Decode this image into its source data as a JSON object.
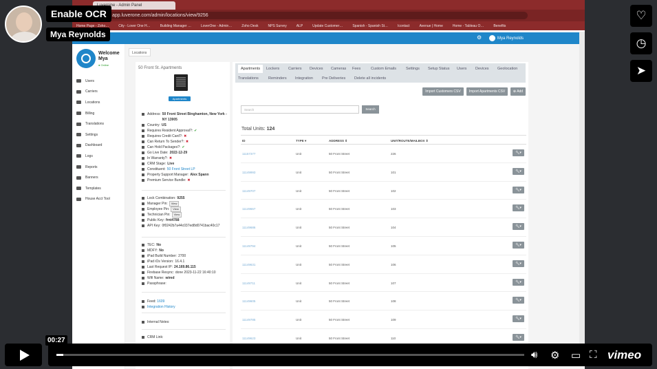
{
  "browser": {
    "tab_title": "Luvernine - Admin Panel",
    "url": "app.luverone.com/admin/locations/view/9256",
    "bookmarks": [
      "Home Page - Zoho…",
      "City - Lover One H…",
      "Building Manager …",
      "LoverOne - Admin…",
      "Zoho Desk",
      "NPS Survey",
      "ALP",
      "Update Customer…",
      "Spanish - Spanish St…",
      "Icontact",
      "Avenue | Home",
      "Home - Tableau O…",
      "Benefits"
    ]
  },
  "app": {
    "header_user": "Mya Reynolds",
    "sidebar_title_line1": "Welcome",
    "sidebar_title_line2": "Mya",
    "online": "● Online",
    "nav": [
      "Users",
      "Carriers",
      "Locations",
      "Billing",
      "Translations",
      "Settings",
      "Dashboard",
      "Logs",
      "Reports",
      "Banners",
      "Templates",
      "House Acct Tool"
    ]
  },
  "breadcrumb_tab": "Locations",
  "location": {
    "name": "50 Front St. Apartments",
    "type_badge": "Apartments",
    "details": [
      {
        "label": "Address:",
        "value": "50 Front Street Binghamton, New York - NY 13905",
        "style": "bold"
      },
      {
        "label": "Country:",
        "value": "US",
        "style": "bold"
      },
      {
        "label": "Requires Resident Approval?:",
        "value": "✔",
        "style": "ok"
      },
      {
        "label": "Requires Credit Card?:",
        "value": "✖",
        "style": "no"
      },
      {
        "label": "Can Return To Sender?:",
        "value": "✖",
        "style": "no"
      },
      {
        "label": "Can Hold Packages?:",
        "value": "✔",
        "style": "ok"
      },
      {
        "label": "Go Live Date:",
        "value": "2022-12-29",
        "style": "bold"
      },
      {
        "label": "In Warranty?:",
        "value": "✖",
        "style": "no"
      },
      {
        "label": "CRM Stage:",
        "value": "Live",
        "style": "bold"
      },
      {
        "label": "Constituent:",
        "value": "50 Front Street LP",
        "style": "link"
      },
      {
        "label": "Property Support Manager:",
        "value": "Alex Spann",
        "style": "bold"
      },
      {
        "label": "Premium Service Bundle:",
        "value": "✖",
        "style": "no"
      }
    ],
    "security": [
      {
        "label": "Lock Combination:",
        "value": "9255",
        "style": "bold"
      },
      {
        "label": "Manager Pin:",
        "value": "View",
        "style": "button"
      },
      {
        "label": "Employee Pin:",
        "value": "View",
        "style": "button"
      },
      {
        "label": "Technician Pin:",
        "value": "View",
        "style": "button"
      },
      {
        "label": "Public Key:",
        "value": "frnt4788",
        "style": "bold"
      },
      {
        "label": "API Key:",
        "value": "0f0242b7a44c037ed8d0741bac40c17",
        "style": "plain"
      }
    ],
    "device": [
      {
        "label": "TEC:",
        "value": "No",
        "style": "bold"
      },
      {
        "label": "MDFY:",
        "value": "No",
        "style": "bold"
      },
      {
        "label": "iPad Build Number:",
        "value": "2700",
        "style": "plain"
      },
      {
        "label": "iPad iOs Version:",
        "value": "16.4.1",
        "style": "plain"
      },
      {
        "label": "Last Request IP:",
        "value": "24.169.86.115",
        "style": "bold"
      },
      {
        "label": "Firebase Resync:",
        "value": "done 2023-11-22 16:40:10",
        "style": "plain"
      },
      {
        "label": "Wifi Name:",
        "value": "wired",
        "style": "bold"
      },
      {
        "label": "Passphrase:",
        "value": "",
        "style": "plain"
      }
    ],
    "feed_label": "Feed:",
    "feed_value": "1609",
    "integration_history": "Integration History",
    "internal_notes": "Internal Notes:",
    "crm_link": "CRM Link:"
  },
  "tabs_row1": [
    "Apartments",
    "Lockers",
    "Carriers",
    "Devices",
    "Cameras",
    "Fees",
    "Custom Emails",
    "Settings",
    "Setup Status",
    "Users",
    "Devices",
    "Geolocation"
  ],
  "tabs_row2": [
    "Translations",
    "Reminders",
    "Integration",
    "Pre Deliveries",
    "Delete all incidents"
  ],
  "actions": {
    "import_customers": "Import Customers CSV",
    "import_apartments": "Import Apartments CSV",
    "add": "⊕ Add"
  },
  "search": {
    "placeholder": "Search",
    "button": "Search"
  },
  "total_label": "Total Units:",
  "total_value": "124",
  "table": {
    "headers": [
      "ID",
      "TYPE ▾",
      "ADDRESS ⇕",
      "UNIT/ROUTE/MAILBOX ⇕"
    ],
    "rows": [
      {
        "id": "11157377",
        "type": "Unit",
        "address": "50 Front Street",
        "unit": "226"
      },
      {
        "id": "11149993",
        "type": "Unit",
        "address": "50 Front Street",
        "unit": "101"
      },
      {
        "id": "11149707",
        "type": "Unit",
        "address": "50 Front Street",
        "unit": "102"
      },
      {
        "id": "11149667",
        "type": "Unit",
        "address": "50 Front Street",
        "unit": "103"
      },
      {
        "id": "11149686",
        "type": "Unit",
        "address": "50 Front Street",
        "unit": "104"
      },
      {
        "id": "11149794",
        "type": "Unit",
        "address": "50 Front Street",
        "unit": "105"
      },
      {
        "id": "11149631",
        "type": "Unit",
        "address": "50 Front Street",
        "unit": "106"
      },
      {
        "id": "11149711",
        "type": "Unit",
        "address": "50 Front Street",
        "unit": "107"
      },
      {
        "id": "11149605",
        "type": "Unit",
        "address": "50 Front Street",
        "unit": "108"
      },
      {
        "id": "11149785",
        "type": "Unit",
        "address": "50 Front Street",
        "unit": "109"
      },
      {
        "id": "11149623",
        "type": "Unit",
        "address": "50 Front Street",
        "unit": "110"
      }
    ],
    "action_icon": "wrench-icon ▾"
  },
  "video": {
    "ocr_label": "Enable OCR",
    "presenter": "Mya Reynolds",
    "time": "00:27",
    "progress_fraction": 0.015,
    "brand": "vimeo"
  }
}
